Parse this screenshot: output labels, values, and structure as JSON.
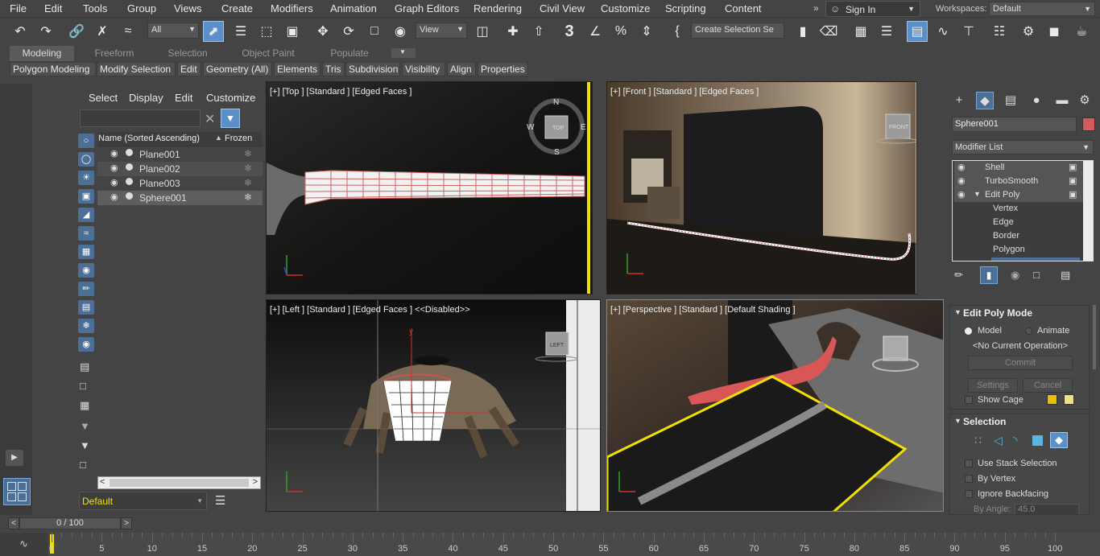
{
  "menu": [
    "File",
    "Edit",
    "Tools",
    "Group",
    "Views",
    "Create",
    "Modifiers",
    "Animation",
    "Graph Editors",
    "Rendering",
    "Civil View",
    "Customize",
    "Scripting",
    "Content"
  ],
  "account": {
    "sign_in": "Sign In",
    "workspaces_label": "Workspaces:",
    "workspace_value": "Default"
  },
  "toolbar": {
    "filter_value": "All",
    "view_value": "View",
    "selection_set_placeholder": "Create Selection Se",
    "snap_value": "3"
  },
  "ribbon": {
    "tabs": [
      "Modeling",
      "Freeform",
      "Selection",
      "Object Paint",
      "Populate"
    ],
    "buttons": [
      "Polygon Modeling",
      "Modify Selection",
      "Edit",
      "Geometry (All)",
      "Elements",
      "Tris",
      "Subdivision",
      "Visibility",
      "Align",
      "Properties"
    ]
  },
  "scene_explorer": {
    "menu": [
      "Select",
      "Display",
      "Edit",
      "Customize"
    ],
    "col_name": "Name (Sorted Ascending)",
    "col_frozen": "Frozen",
    "objects": [
      "Plane001",
      "Plane002",
      "Plane003",
      "Sphere001"
    ],
    "layer_value": "Default"
  },
  "viewports": {
    "top": {
      "label": "[+] [Top ] [Standard ] [Edged Faces ]",
      "cube": "TOP",
      "compass": [
        "N",
        "S",
        "W",
        "E"
      ]
    },
    "front": {
      "label": "[+] [Front ] [Standard ] [Edged Faces ]",
      "cube": "FRONT"
    },
    "left": {
      "label": "[+] [Left ] [Standard ] [Edged Faces ]  <<Disabled>>",
      "cube": "LEFT",
      "axis_y": "y"
    },
    "perspective": {
      "label": "[+] [Perspective ] [Standard ] [Default Shading ]"
    }
  },
  "command_panel": {
    "object_name": "Sphere001",
    "modifier_list": "Modifier List",
    "stack": [
      "Shell",
      "TurboSmooth",
      "Edit Poly",
      "Vertex",
      "Edge",
      "Border",
      "Polygon"
    ],
    "edit_poly_mode": {
      "title": "Edit Poly Mode",
      "model": "Model",
      "animate": "Animate",
      "current_op": "<No Current Operation>",
      "commit": "Commit",
      "settings": "Settings",
      "cancel": "Cancel",
      "show_cage": "Show Cage"
    },
    "selection": {
      "title": "Selection",
      "use_stack": "Use Stack Selection",
      "by_vertex": "By Vertex",
      "ignore_backfacing": "Ignore Backfacing",
      "by_angle": "By Angle:",
      "angle_value": "45.0"
    }
  },
  "timeline": {
    "frame": "0 / 100",
    "ticks": [
      "0",
      "5",
      "10",
      "15",
      "20",
      "25",
      "30",
      "35",
      "40",
      "45",
      "50",
      "55",
      "60",
      "65",
      "70",
      "75",
      "80",
      "85",
      "90",
      "95",
      "100"
    ]
  },
  "colors": {
    "accent": "#5a8fc7",
    "selection_yellow": "#f0e000",
    "object_color": "#d65a5a",
    "cage_yellow": "#e8c000"
  }
}
